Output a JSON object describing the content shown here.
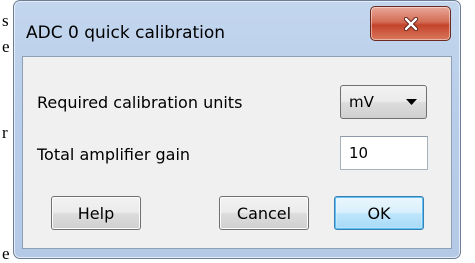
{
  "background": {
    "fragments": [
      "s",
      "e",
      "r",
      "e"
    ]
  },
  "dialog": {
    "title": "ADC 0 quick calibration",
    "close_icon": "close-x-icon",
    "units_label": "Required calibration units",
    "units_value": "mV",
    "gain_label": "Total amplifier gain",
    "gain_value": "10",
    "help_label": "Help",
    "cancel_label": "Cancel",
    "ok_label": "OK"
  },
  "colors": {
    "title_bar": "#b8cde9",
    "close_button": "#c94a31",
    "default_button_border": "#3c7fb1",
    "client_area": "#f0f0f0"
  }
}
